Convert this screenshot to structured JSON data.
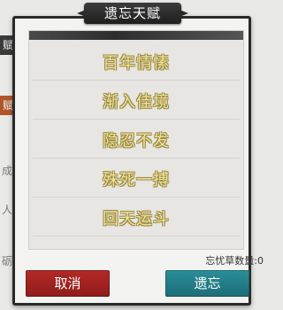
{
  "dialog": {
    "title": "遗忘天赋",
    "items": [
      {
        "label": "百年情愫"
      },
      {
        "label": "渐入佳境"
      },
      {
        "label": "隐忍不发"
      },
      {
        "label": "殊死一搏"
      },
      {
        "label": "回天运斗"
      }
    ],
    "counter": "忘忧草数量:0",
    "cancel_label": "取消",
    "forget_label": "遗忘"
  },
  "background": {
    "strip1": "赋",
    "strip2": "赋",
    "text1": "成",
    "text2": "人",
    "text3": "砺"
  },
  "colors": {
    "item_text": "#efe39a",
    "cancel_button": "#a52421",
    "forget_button": "#248088",
    "title_bar": "#2a2a2a"
  }
}
